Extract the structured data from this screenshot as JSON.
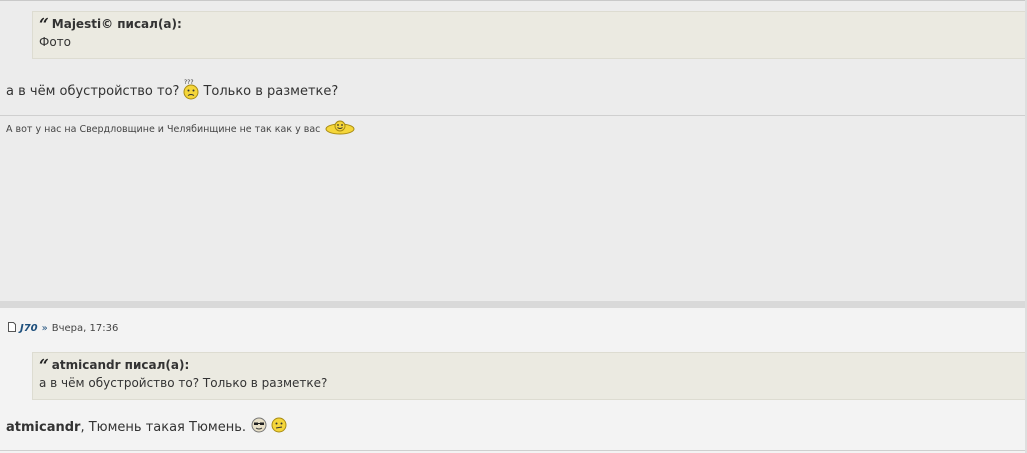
{
  "post1": {
    "quote": {
      "author_label": "Majesti© писал(а):",
      "text": "Фото"
    },
    "message_before": "а в чём обустройство то?",
    "message_after": "Только в разметке?",
    "signature": "А вот у нас на Свердловщине и Челябинщине не так как у вас",
    "smiley_confused_icon": "confused-smiley-icon",
    "smiley_signature_icon": "dancing-smiley-icon"
  },
  "post2": {
    "meta": {
      "author": "J70",
      "separator": "»",
      "date": "Вчера, 17:36"
    },
    "quote": {
      "author_label": "atmicandr писал(а):",
      "text": "а в чём обустройство то? Только в разметке?"
    },
    "message_name": "atmicandr",
    "message_rest": ", Тюмень такая Тюмень.",
    "smiley_icons": [
      "sunglasses-smiley-icon",
      "thinking-smiley-icon"
    ]
  },
  "colors": {
    "post_bg": "#ececec",
    "post2_bg": "#f3f3f3",
    "quote_bg": "#ebeae1",
    "link": "#1d4f7c"
  }
}
